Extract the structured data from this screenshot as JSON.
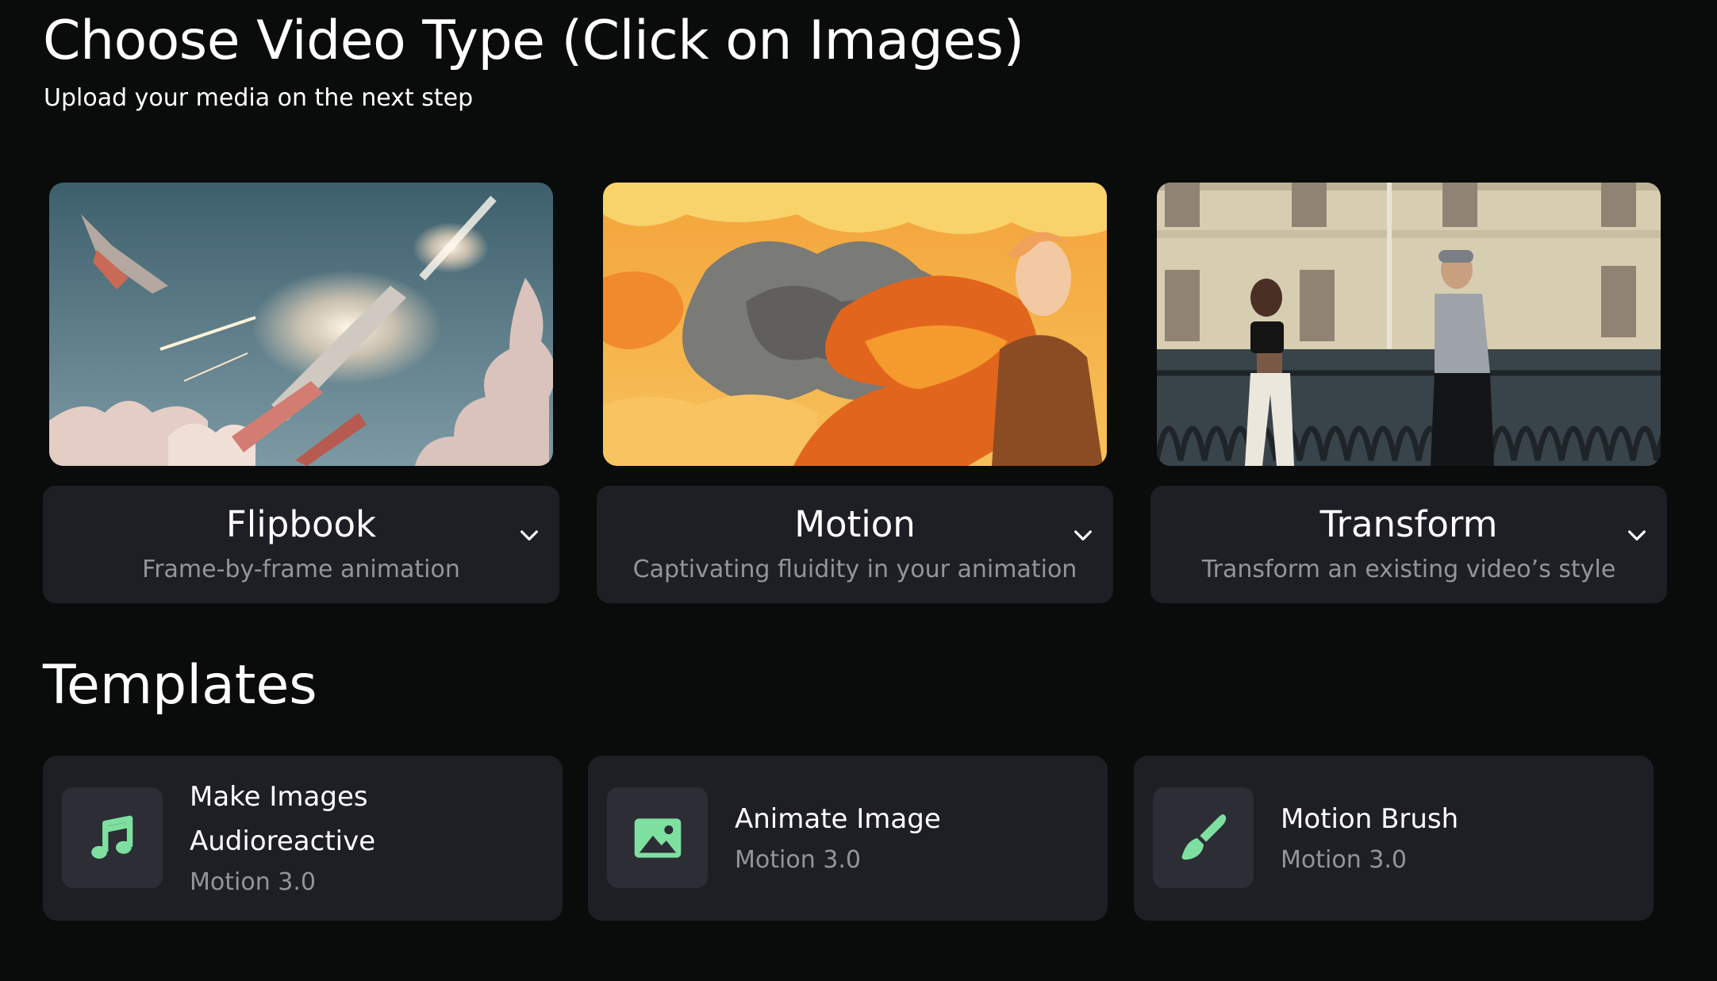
{
  "header": {
    "title": "Choose Video Type (Click on Images)",
    "subtitle": "Upload your media on the next step"
  },
  "video_types": [
    {
      "title": "Flipbook",
      "description": "Frame-by-frame animation",
      "icon": "chevron-down-icon"
    },
    {
      "title": "Motion",
      "description": "Captivating fluidity in your animation",
      "icon": "chevron-down-icon"
    },
    {
      "title": "Transform",
      "description": "Transform an existing video’s style",
      "icon": "chevron-down-icon"
    }
  ],
  "templates_section": {
    "title": "Templates",
    "items": [
      {
        "line1": "Make Images",
        "line2": "Audioreactive",
        "sub": "Motion 3.0",
        "icon": "music-note-icon"
      },
      {
        "line1": "Animate Image",
        "sub": "Motion 3.0",
        "icon": "image-icon"
      },
      {
        "line1": "Motion Brush",
        "sub": "Motion 3.0",
        "icon": "paintbrush-icon"
      }
    ]
  },
  "colors": {
    "background": "#0a0b0b",
    "card": "#1e1f25",
    "icon_tile": "#2c2d35",
    "accent_green": "#7ee0a0",
    "muted_text": "#94959b"
  }
}
